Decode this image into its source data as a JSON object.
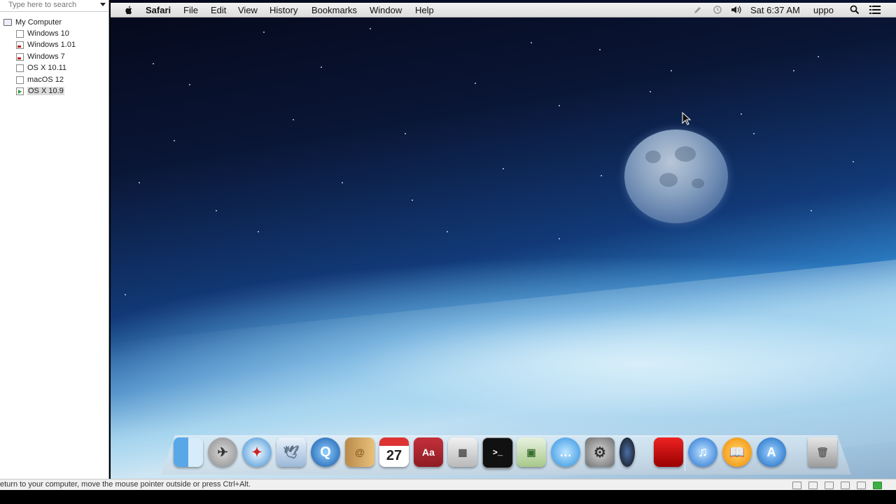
{
  "sidebar": {
    "search_placeholder": "Type here to search",
    "root_label": "My Computer",
    "vms": [
      {
        "label": "Windows 10"
      },
      {
        "label": "Windows 1.01"
      },
      {
        "label": "Windows 7"
      },
      {
        "label": "OS X 10.11"
      },
      {
        "label": "macOS 12"
      },
      {
        "label": "OS X 10.9"
      }
    ]
  },
  "menubar": {
    "app": "Safari",
    "menus": [
      "File",
      "Edit",
      "View",
      "History",
      "Bookmarks",
      "Window",
      "Help"
    ],
    "clock": "Sat 6:37 AM",
    "user": "uppo"
  },
  "dock": {
    "calendar_day": "27",
    "dictionary_label": "Aa",
    "items": [
      "finder-icon",
      "launchpad-icon",
      "safari-icon",
      "mail-icon",
      "quicktime-icon",
      "contacts-icon",
      "calendar-icon",
      "dictionary-icon",
      "calculator-icon",
      "terminal-icon",
      "preview-icon",
      "messages-icon",
      "system-preferences-icon",
      "photo-booth-icon",
      "photo-booth-red-icon",
      "itunes-icon",
      "ibooks-icon",
      "app-store-icon",
      "trash-icon"
    ]
  },
  "statusbar": {
    "message": "eturn to your computer, move the mouse pointer outside or press Ctrl+Alt."
  }
}
